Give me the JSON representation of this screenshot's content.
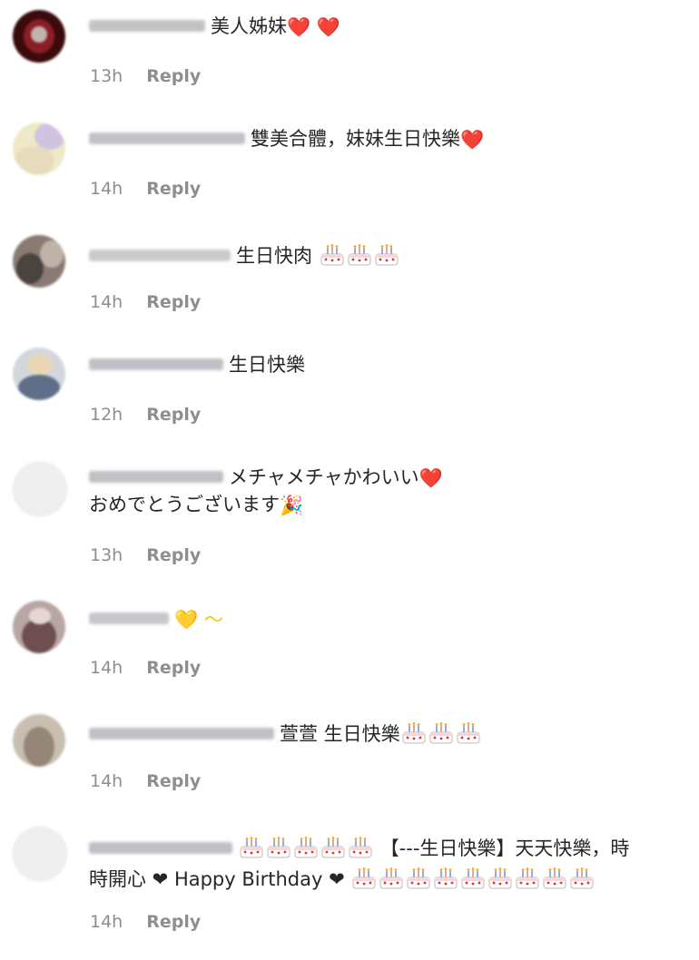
{
  "comments": [
    {
      "text": "美人姊妹",
      "emoji_after": "❤️ ❤️",
      "time": "13h",
      "reply": "Reply",
      "avatar_colors": [
        "#3a0a0c",
        "#8a1e24"
      ],
      "uname_color": "#b9b9bc"
    },
    {
      "text": "雙美合體，妹妹生日快樂",
      "emoji_after": "❤️",
      "time": "14h",
      "reply": "Reply",
      "avatar_colors": [
        "#efe9c6",
        "#cfc3a8"
      ],
      "uname_color": "#b7b7bd"
    },
    {
      "text": "生日快肉",
      "emoji_after": "🎂 🎂 🎂",
      "time": "14h",
      "reply": "Reply",
      "avatar_colors": [
        "#8a7b72",
        "#4b433f"
      ],
      "uname_color": "#c2c2c6"
    },
    {
      "text": "生日快樂",
      "emoji_after": "",
      "time": "12h",
      "reply": "Reply",
      "avatar_colors": [
        "#d3d7dc",
        "#5f6f8a"
      ],
      "uname_color": "#b4b5bb"
    },
    {
      "text": "メチャメチャかわいい",
      "emoji_after": "❤️",
      "text2": "おめでとうございます",
      "emoji2": "🎉",
      "time": "13h",
      "reply": "Reply",
      "avatar_colors": [
        "#f1f1f1",
        "#e1e1e1"
      ],
      "uname_color": "#b6b6bb"
    },
    {
      "text": "",
      "emoji_after": "💛 ～",
      "time": "14h",
      "reply": "Reply",
      "avatar_colors": [
        "#b8a6a4",
        "#6e4e4f"
      ],
      "uname_color": "#bdbdc2"
    },
    {
      "text": "萱萱 生日快樂",
      "emoji_after": "🎂 🎂 🎂",
      "time": "14h",
      "reply": "Reply",
      "avatar_colors": [
        "#c9bfb0",
        "#958678"
      ],
      "uname_color": "#b6b6bb"
    },
    {
      "text": "【---生日快樂】天天快樂，時",
      "pre_emoji": "🎂 🎂 🎂 🎂 🎂",
      "text2": "時開心 ❤ Happy Birthday ❤",
      "emoji2": "🎂 🎂 🎂 🎂 🎂 🎂 🎂 🎂 🎂",
      "time": "14h",
      "reply": "Reply",
      "avatar_colors": [
        "#f1f1f1",
        "#e3e3e3"
      ],
      "uname_color": "#b4b4ba"
    }
  ]
}
